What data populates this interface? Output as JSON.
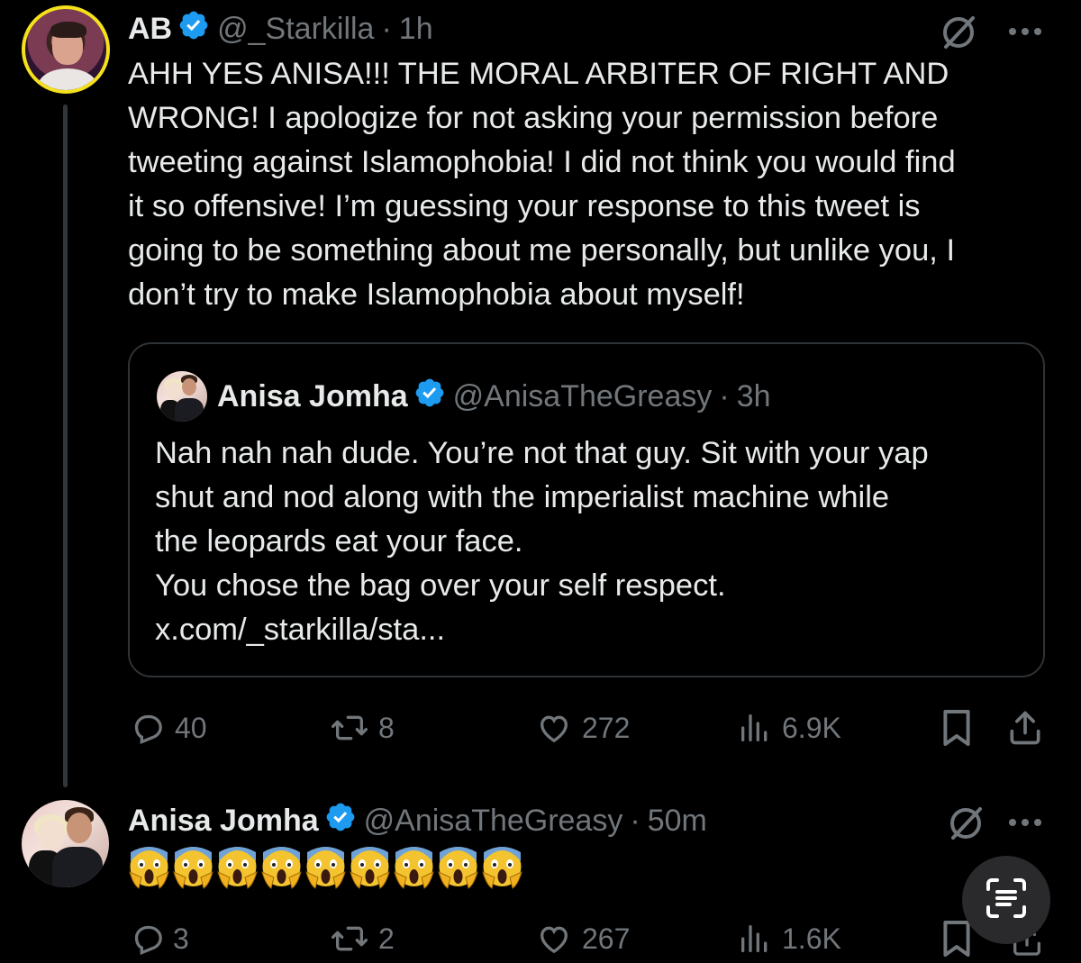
{
  "main_tweet": {
    "author_name": "AB",
    "handle": "@_Starkilla",
    "separator": "·",
    "time": "1h",
    "text": "AHH YES ANISA!!! THE MORAL ARBITER OF RIGHT AND\nWRONG! I apologize for not asking your permission before\ntweeting against Islamophobia! I did not think you would find\nit so offensive! I’m guessing your response to this tweet is\ngoing to be something about me personally, but unlike you, I\ndon’t try to make Islamophobia about myself!",
    "quote": {
      "author_name": "Anisa Jomha",
      "handle": "@AnisaTheGreasy",
      "separator": "·",
      "time": "3h",
      "text": "Nah nah nah dude. You’re not that guy. Sit with your yap\nshut and nod along with the imperialist machine while\nthe leopards eat your face.\nYou chose the bag over your self respect.\nx.com/_starkilla/sta..."
    },
    "actions": {
      "replies": "40",
      "reposts": "8",
      "likes": "272",
      "views": "6.9K"
    }
  },
  "reply_tweet": {
    "author_name": "Anisa Jomha",
    "handle": "@AnisaTheGreasy",
    "separator": "·",
    "time": "50m",
    "emoji_text": "😱😱😱😱😱😱😱😱😱",
    "actions": {
      "replies": "3",
      "reposts": "2",
      "likes": "267",
      "views": "1.6K"
    }
  },
  "icons": {
    "verified": "verified-badge-icon",
    "grok": "grok-icon",
    "more": "more-icon",
    "reply": "reply-icon",
    "repost": "repost-icon",
    "like": "heart-icon",
    "views": "views-icon",
    "bookmark": "bookmark-icon",
    "share": "share-icon",
    "scan": "text-scan-icon"
  },
  "colors": {
    "background": "#000000",
    "text": "#e7e9ea",
    "muted": "#71767b",
    "verified": "#1d9bf0",
    "avatar_ring": "#f5e11b",
    "border": "#2f3336"
  }
}
